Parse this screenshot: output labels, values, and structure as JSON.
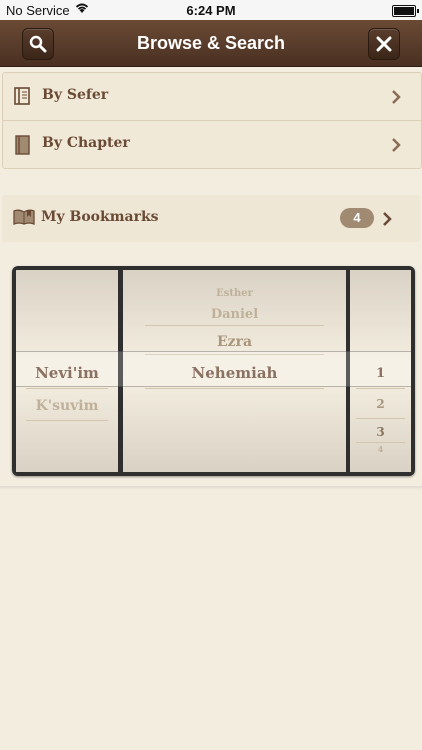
{
  "status_bar": {
    "carrier": "No Service",
    "time": "6:24 PM"
  },
  "nav": {
    "title": "Browse & Search"
  },
  "menu": {
    "by_sefer": "By Sefer",
    "by_chapter": "By Chapter",
    "bookmarks": "My Bookmarks",
    "bookmark_count": "4"
  },
  "picker": {
    "column1": {
      "selected": "Nevi'im",
      "below": "K'suvim"
    },
    "column2": {
      "above3": "Esther",
      "above2": "Daniel",
      "above1": "Ezra",
      "selected": "Nehemiah"
    },
    "column3": {
      "selected": "1",
      "below1": "2",
      "below2": "3",
      "below3": "4"
    }
  },
  "colors": {
    "accent": "#6a4a35",
    "navbar": "#4a3022",
    "background": "#f3ede0"
  }
}
